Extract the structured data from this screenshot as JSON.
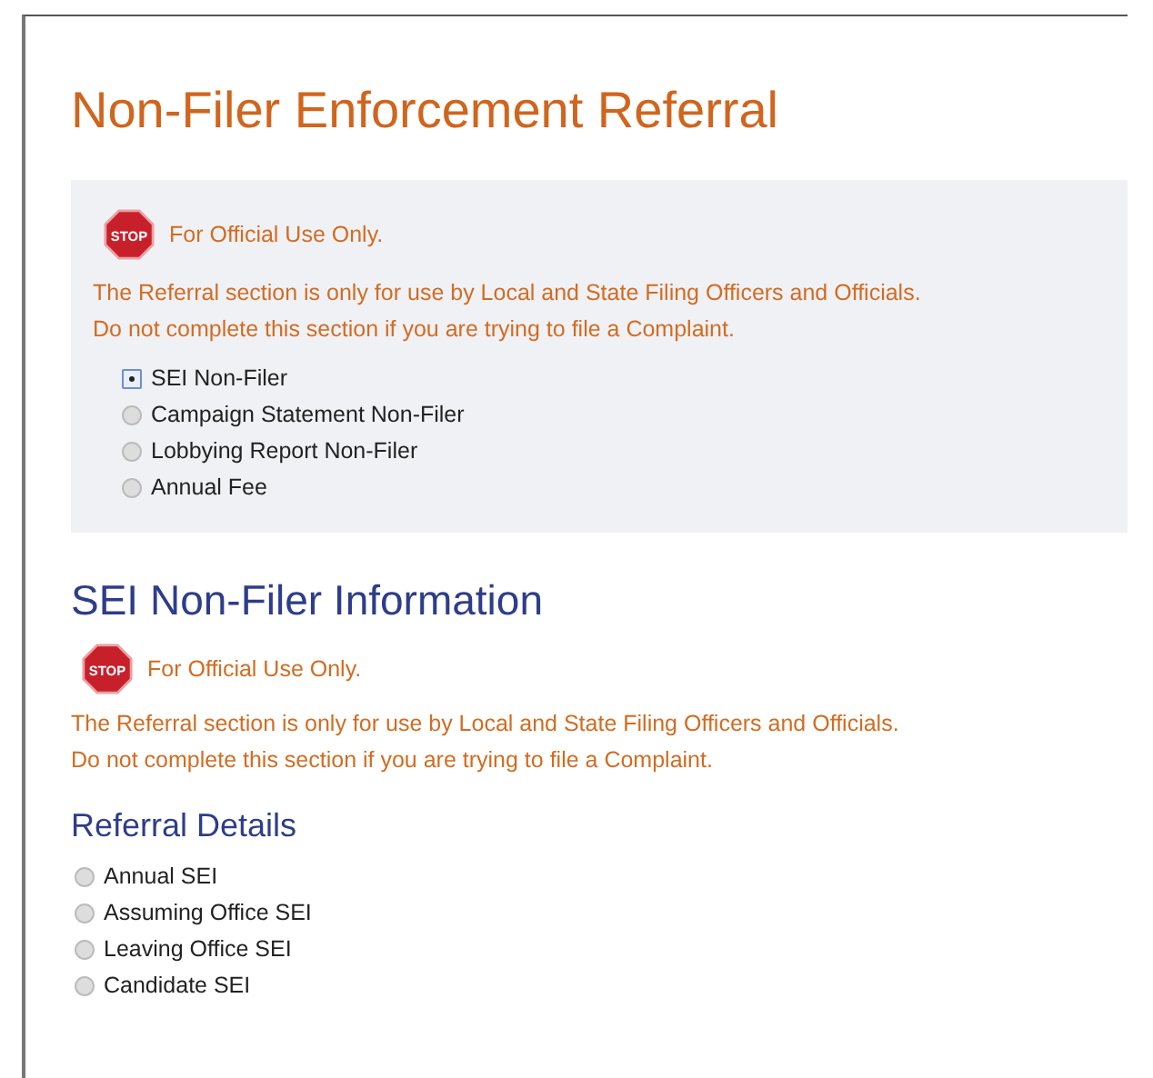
{
  "title": "Non-Filer Enforcement Referral",
  "referral_panel": {
    "notice": {
      "stop_label": "STOP",
      "heading": "For Official Use Only.",
      "lines": [
        "The Referral section is only for use by Local and State Filing Officers and Officials.",
        "Do not complete this section if you are trying to file a Complaint."
      ]
    },
    "options": [
      {
        "label": "SEI Non-Filer",
        "selected": true
      },
      {
        "label": "Campaign Statement Non-Filer",
        "selected": false
      },
      {
        "label": "Lobbying Report Non-Filer",
        "selected": false
      },
      {
        "label": "Annual Fee",
        "selected": false
      }
    ]
  },
  "section": {
    "title": "SEI Non-Filer Information",
    "notice": {
      "stop_label": "STOP",
      "heading": "For Official Use Only.",
      "lines": [
        "The Referral section is only for use by Local and State Filing Officers and Officials.",
        "Do not complete this section if you are trying to file a Complaint."
      ]
    },
    "subtitle": "Referral Details",
    "options": [
      {
        "label": "Annual SEI",
        "selected": false
      },
      {
        "label": "Assuming Office SEI",
        "selected": false
      },
      {
        "label": "Leaving Office SEI",
        "selected": false
      },
      {
        "label": "Candidate SEI",
        "selected": false
      }
    ]
  }
}
